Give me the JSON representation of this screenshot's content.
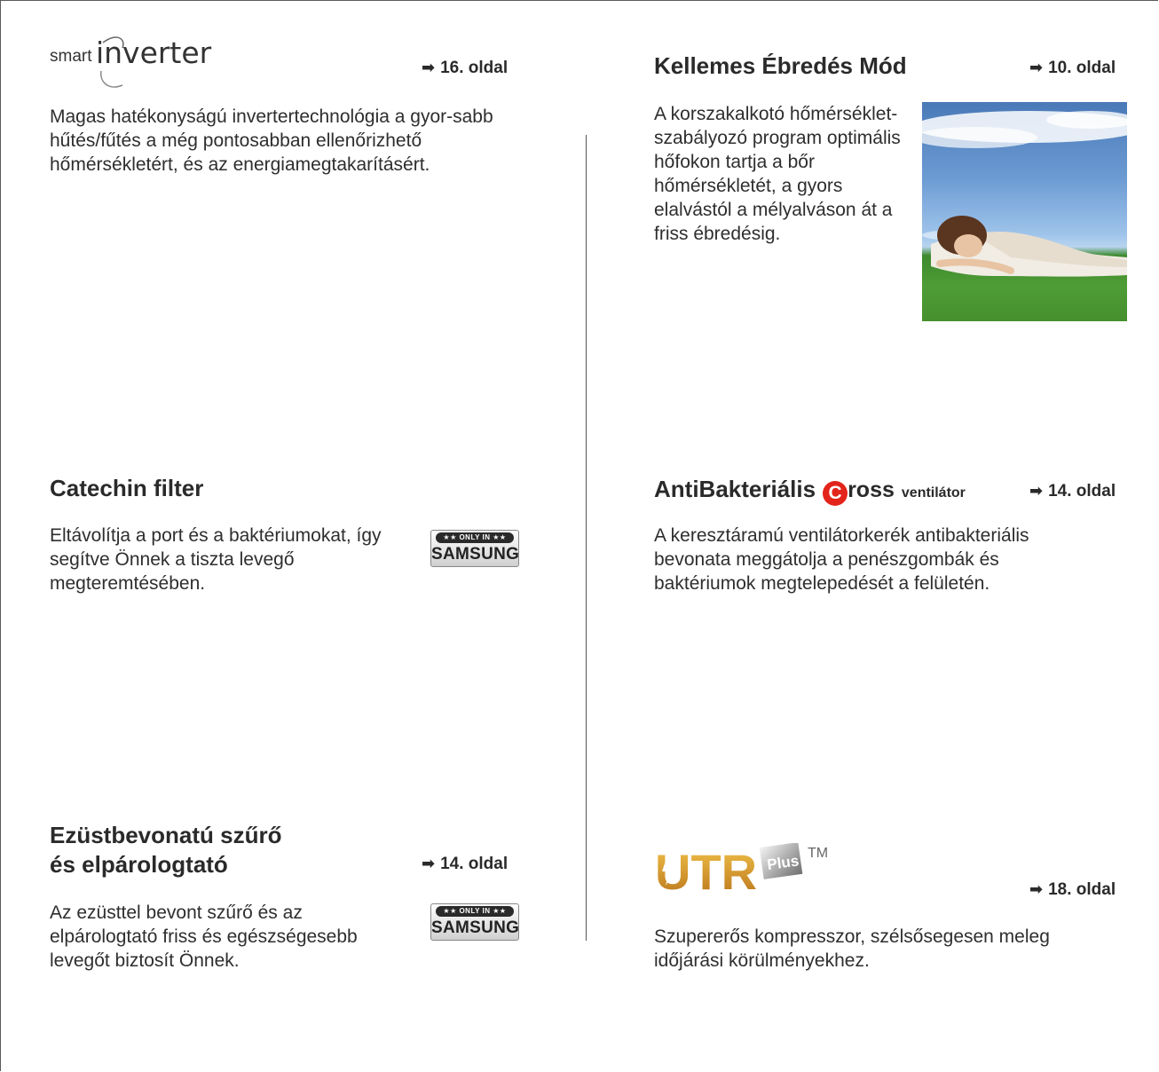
{
  "logos": {
    "smart_small": "smart",
    "smart_large": "inverter",
    "cross_c": "C",
    "cross_rest": "ross",
    "cross_suffix": "ventilátor",
    "utr_text": "UTR",
    "utr_plus": "Plus",
    "utr_tm": "TM"
  },
  "badge": {
    "line1": "★★ ONLY IN ★★",
    "line2": "SAMSUNG"
  },
  "arrow": "➡",
  "sections": {
    "inverter": {
      "page_ref": "16. oldal",
      "text": "Magas hatékonyságú invertertechnológia a gyor-sabb hűtés/fűtés a még pontosabban ellenőrizhető hőmérsékletért, és az energiamegtakarításért."
    },
    "wakeup": {
      "title": "Kellemes Ébredés Mód",
      "page_ref": "10. oldal",
      "text": "A korszakalkotó hőmérséklet-szabályozó program optimális hőfokon tartja a bőr hőmérsékletét, a gyors elalvástól a mélyalváson át a friss ébredésig."
    },
    "catechin": {
      "title": "Catechin filter",
      "text": "Eltávolítja a port és a baktériumokat, így segítve Önnek a tiszta levegő megteremtésében."
    },
    "antibacterial": {
      "title": "AntiBakteriális",
      "page_ref": "14. oldal",
      "text": "A keresztáramú ventilátorkerék antibakteriális bevonata meggátolja a penészgombák és baktériumok megtelepedését a felületén."
    },
    "silver": {
      "title_line1": "Ezüstbevonatú szűrő",
      "title_line2": "és elpárologtató",
      "page_ref": "14. oldal",
      "text": "Az ezüsttel bevont szűrő és az elpárologtató friss és egészségesebb levegőt biztosít Önnek."
    },
    "utr": {
      "page_ref": "18. oldal",
      "text": "Szupererős kompresszor, szélsősegesen meleg időjárási körülményekhez."
    }
  }
}
